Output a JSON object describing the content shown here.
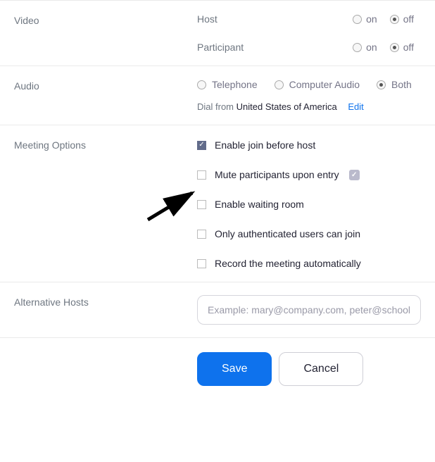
{
  "video": {
    "label": "Video",
    "host": {
      "label": "Host",
      "on_label": "on",
      "off_label": "off",
      "value": "off"
    },
    "participant": {
      "label": "Participant",
      "on_label": "on",
      "off_label": "off",
      "value": "off"
    }
  },
  "audio": {
    "label": "Audio",
    "options": {
      "telephone": "Telephone",
      "computer": "Computer Audio",
      "both": "Both"
    },
    "value": "both",
    "dial_prefix": "Dial from",
    "dial_country": "United States of America",
    "edit_label": "Edit"
  },
  "meeting_options": {
    "label": "Meeting Options",
    "items": [
      {
        "label": "Enable join before host",
        "checked": true
      },
      {
        "label": "Mute participants upon entry",
        "checked": false,
        "info": true
      },
      {
        "label": "Enable waiting room",
        "checked": false
      },
      {
        "label": "Only authenticated users can join",
        "checked": false
      },
      {
        "label": "Record the meeting automatically",
        "checked": false
      }
    ]
  },
  "alt_hosts": {
    "label": "Alternative Hosts",
    "placeholder": "Example: mary@company.com, peter@school.edu"
  },
  "buttons": {
    "save": "Save",
    "cancel": "Cancel"
  }
}
